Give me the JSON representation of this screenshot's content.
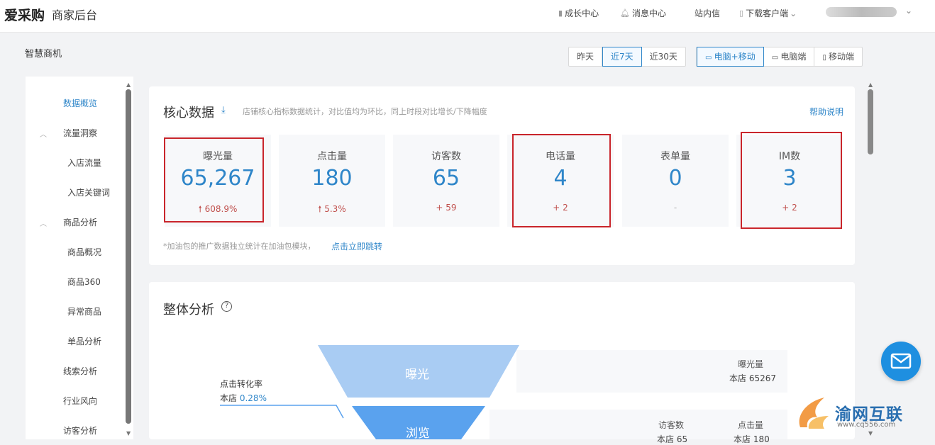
{
  "header": {
    "logo": "爱采购",
    "platform": "商家后台",
    "nav": [
      {
        "icon": "book-icon",
        "label": "成长中心"
      },
      {
        "icon": "bell-icon",
        "label": "消息中心"
      },
      {
        "icon": "",
        "label": "站内信"
      },
      {
        "icon": "phone-icon",
        "label": "下载客户端"
      }
    ],
    "user_caret": "⌄"
  },
  "page": {
    "title": "智慧商机",
    "date_filters": [
      "昨天",
      "近7天",
      "近30天"
    ],
    "date_selected": "近7天",
    "device_filters": [
      "电脑+移动",
      "电脑端",
      "移动端"
    ],
    "device_selected": "电脑+移动"
  },
  "sidebar": {
    "items": [
      {
        "label": "数据概览",
        "active": true
      },
      {
        "label": "流量洞察",
        "group": true
      },
      {
        "label": "入店流量"
      },
      {
        "label": "入店关键词"
      },
      {
        "label": "商品分析",
        "group": true
      },
      {
        "label": "商品概况"
      },
      {
        "label": "商品360"
      },
      {
        "label": "异常商品"
      },
      {
        "label": "单品分析"
      },
      {
        "label": "线索分析"
      },
      {
        "label": "行业风向"
      },
      {
        "label": "访客分析"
      }
    ]
  },
  "core": {
    "title": "核心数据",
    "description": "店铺核心指标数据统计，对比值均为环比，同上时段对比增长/下降幅度",
    "help": "帮助说明",
    "metrics": [
      {
        "label": "曝光量",
        "value": "65,267",
        "change": "608.9%",
        "arrow": "🠕",
        "highlight": true
      },
      {
        "label": "点击量",
        "value": "180",
        "change": "5.3%",
        "arrow": "🠕",
        "highlight": false
      },
      {
        "label": "访客数",
        "value": "65",
        "change": "+ 59",
        "highlight": false
      },
      {
        "label": "电话量",
        "value": "4",
        "change": "+ 2",
        "highlight": true
      },
      {
        "label": "表单量",
        "value": "0",
        "change": "-",
        "highlight": false
      },
      {
        "label": "IM数",
        "value": "3",
        "change": "+ 2",
        "highlight": true
      }
    ],
    "note": "*加油包的推广数据独立统计在加油包模块，",
    "note_link": "点击立即跳转"
  },
  "overall": {
    "title": "整体分析",
    "funnel": [
      {
        "label": "曝光",
        "color": "#a9ccf3"
      },
      {
        "label": "浏览",
        "color": "#5aa2ee"
      }
    ],
    "click_rate": {
      "title": "点击转化率",
      "prefix": "本店",
      "value": "0.28%"
    },
    "exposure": {
      "label": "曝光量",
      "value": "本店 65267"
    },
    "visitors": {
      "label": "访客数",
      "value": "本店 65"
    },
    "clicks": {
      "label": "点击量",
      "value": "本店 180"
    }
  },
  "watermark": {
    "text": "渝网互联",
    "url": "www.cq556.com"
  }
}
